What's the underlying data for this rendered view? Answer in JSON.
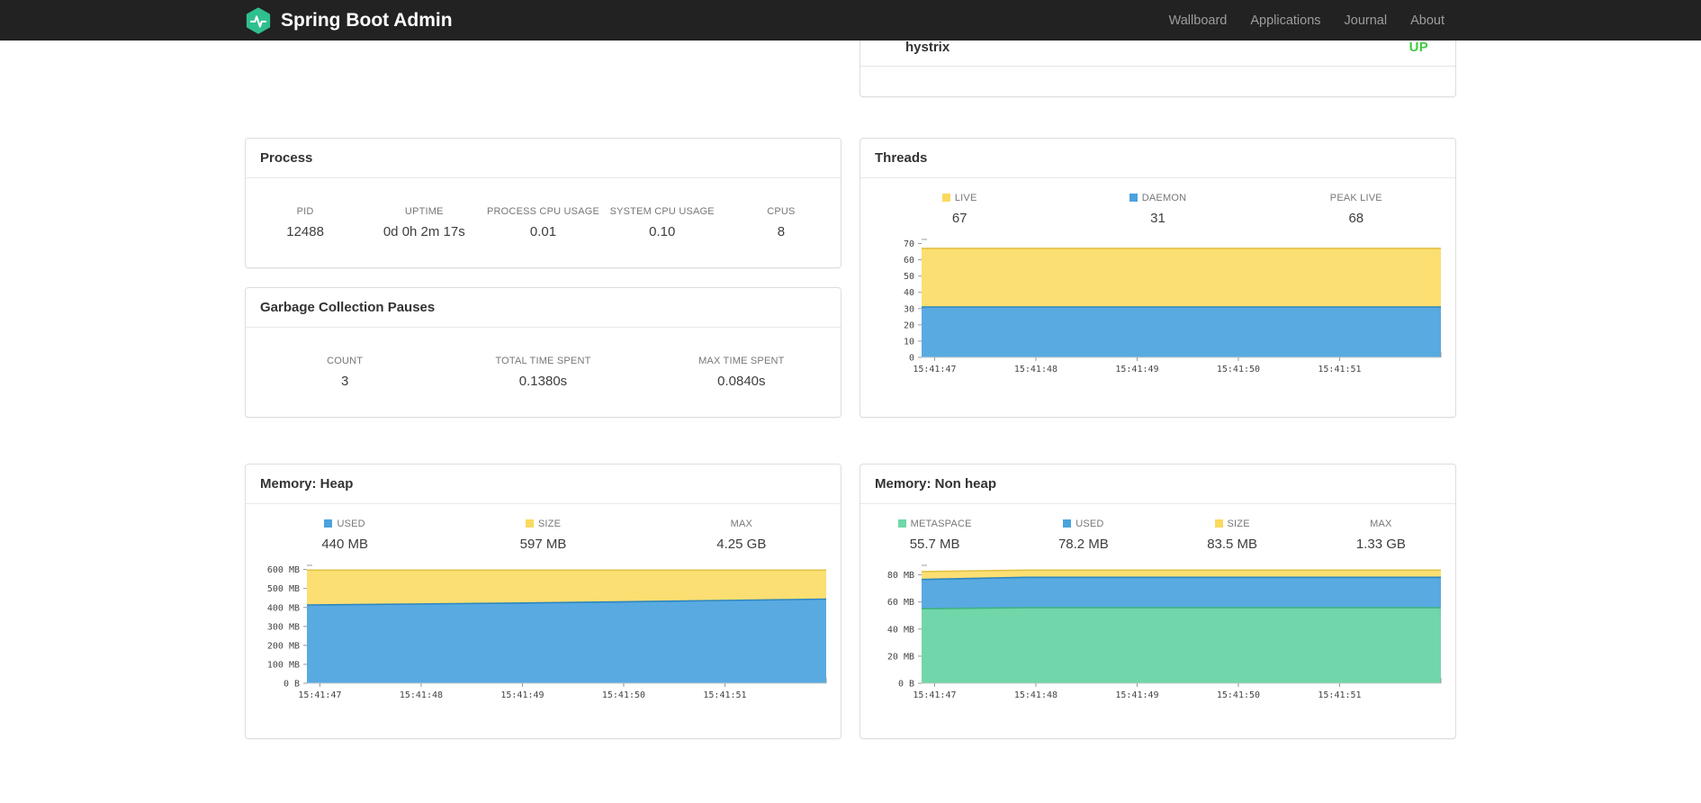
{
  "navbar": {
    "brand": "Spring Boot Admin",
    "links": [
      "Wallboard",
      "Applications",
      "Journal",
      "About"
    ]
  },
  "status_panel": {
    "service": "hystrix",
    "status": "UP"
  },
  "colors": {
    "yellow": "#fbd95f",
    "blue": "#4ba3de",
    "green": "#6fd7a8",
    "up_green": "#3fcb3f",
    "logo_teal": "#30bf8f",
    "navbar_bg": "#222222"
  },
  "panels": {
    "process": {
      "title": "Process",
      "stats": [
        {
          "label": "PID",
          "value": "12488"
        },
        {
          "label": "UPTIME",
          "value": "0d 0h 2m 17s"
        },
        {
          "label": "PROCESS CPU USAGE",
          "value": "0.01"
        },
        {
          "label": "SYSTEM CPU USAGE",
          "value": "0.10"
        },
        {
          "label": "CPUS",
          "value": "8"
        }
      ]
    },
    "gc": {
      "title": "Garbage Collection Pauses",
      "stats": [
        {
          "label": "COUNT",
          "value": "3"
        },
        {
          "label": "TOTAL TIME SPENT",
          "value": "0.1380s"
        },
        {
          "label": "MAX TIME SPENT",
          "value": "0.0840s"
        }
      ]
    },
    "threads": {
      "title": "Threads",
      "stats": [
        {
          "label": "LIVE",
          "value": "67",
          "swatch": "yellow"
        },
        {
          "label": "DAEMON",
          "value": "31",
          "swatch": "blue"
        },
        {
          "label": "PEAK LIVE",
          "value": "68"
        }
      ]
    },
    "heap": {
      "title": "Memory: Heap",
      "stats": [
        {
          "label": "USED",
          "value": "440 MB",
          "swatch": "blue"
        },
        {
          "label": "SIZE",
          "value": "597 MB",
          "swatch": "yellow"
        },
        {
          "label": "MAX",
          "value": "4.25 GB"
        }
      ]
    },
    "nonheap": {
      "title": "Memory: Non heap",
      "stats": [
        {
          "label": "METASPACE",
          "value": "55.7 MB",
          "swatch": "green"
        },
        {
          "label": "USED",
          "value": "78.2 MB",
          "swatch": "blue"
        },
        {
          "label": "SIZE",
          "value": "83.5 MB",
          "swatch": "yellow"
        },
        {
          "label": "MAX",
          "value": "1.33 GB"
        }
      ]
    }
  },
  "chart_data": [
    {
      "id": "threads-chart",
      "type": "area",
      "title": "Threads",
      "x_labels": [
        "15:41:47",
        "15:41:48",
        "15:41:49",
        "15:41:50",
        "15:41:51"
      ],
      "ylim": [
        0,
        72.5
      ],
      "y_ticks": [
        {
          "v": 0,
          "t": "0"
        },
        {
          "v": 10,
          "t": "10"
        },
        {
          "v": 20,
          "t": "20"
        },
        {
          "v": 30,
          "t": "30"
        },
        {
          "v": 40,
          "t": "40"
        },
        {
          "v": 50,
          "t": "50"
        },
        {
          "v": 60,
          "t": "60"
        },
        {
          "v": 70,
          "t": "70"
        }
      ],
      "series": [
        {
          "name": "LIVE",
          "fill": "#fbdf72",
          "stroke": "#e2c148",
          "values": [
            67,
            67,
            67,
            67,
            67,
            67
          ]
        },
        {
          "name": "DAEMON",
          "fill": "#58aae1",
          "stroke": "#2e86c0",
          "values": [
            31,
            31,
            31,
            31,
            31,
            31
          ]
        }
      ]
    },
    {
      "id": "heap-chart",
      "type": "area",
      "title": "Memory: Heap",
      "x_labels": [
        "15:41:47",
        "15:41:48",
        "15:41:49",
        "15:41:50",
        "15:41:51"
      ],
      "ylim": [
        0,
        622
      ],
      "y_ticks": [
        {
          "v": 0,
          "t": "0 B"
        },
        {
          "v": 100,
          "t": "100 MB"
        },
        {
          "v": 200,
          "t": "200 MB"
        },
        {
          "v": 300,
          "t": "300 MB"
        },
        {
          "v": 400,
          "t": "400 MB"
        },
        {
          "v": 500,
          "t": "500 MB"
        },
        {
          "v": 600,
          "t": "600 MB"
        }
      ],
      "series": [
        {
          "name": "SIZE",
          "fill": "#fbdf72",
          "stroke": "#e2c148",
          "values": [
            597,
            597,
            597,
            597,
            597,
            597
          ]
        },
        {
          "name": "USED",
          "fill": "#58aae1",
          "stroke": "#2e86c0",
          "values": [
            413,
            418,
            423,
            429,
            437,
            444
          ]
        }
      ]
    },
    {
      "id": "nonheap-chart",
      "type": "area",
      "title": "Memory: Non heap",
      "x_labels": [
        "15:41:47",
        "15:41:48",
        "15:41:49",
        "15:41:50",
        "15:41:51"
      ],
      "ylim": [
        0,
        87
      ],
      "y_ticks": [
        {
          "v": 0,
          "t": "0 B"
        },
        {
          "v": 20,
          "t": "20 MB"
        },
        {
          "v": 40,
          "t": "40 MB"
        },
        {
          "v": 60,
          "t": "60 MB"
        },
        {
          "v": 80,
          "t": "80 MB"
        }
      ],
      "series": [
        {
          "name": "SIZE",
          "fill": "#fbdf72",
          "stroke": "#e2c148",
          "values": [
            82.4,
            83.5,
            83.5,
            83.5,
            83.5,
            83.5
          ]
        },
        {
          "name": "USED",
          "fill": "#58aae1",
          "stroke": "#2e86c0",
          "values": [
            76.6,
            78.2,
            78.2,
            78.2,
            78.2,
            78.2
          ]
        },
        {
          "name": "METASPACE",
          "fill": "#71d6a9",
          "stroke": "#3fb384",
          "values": [
            55.0,
            55.7,
            55.7,
            55.7,
            55.7,
            55.7
          ]
        }
      ]
    }
  ]
}
